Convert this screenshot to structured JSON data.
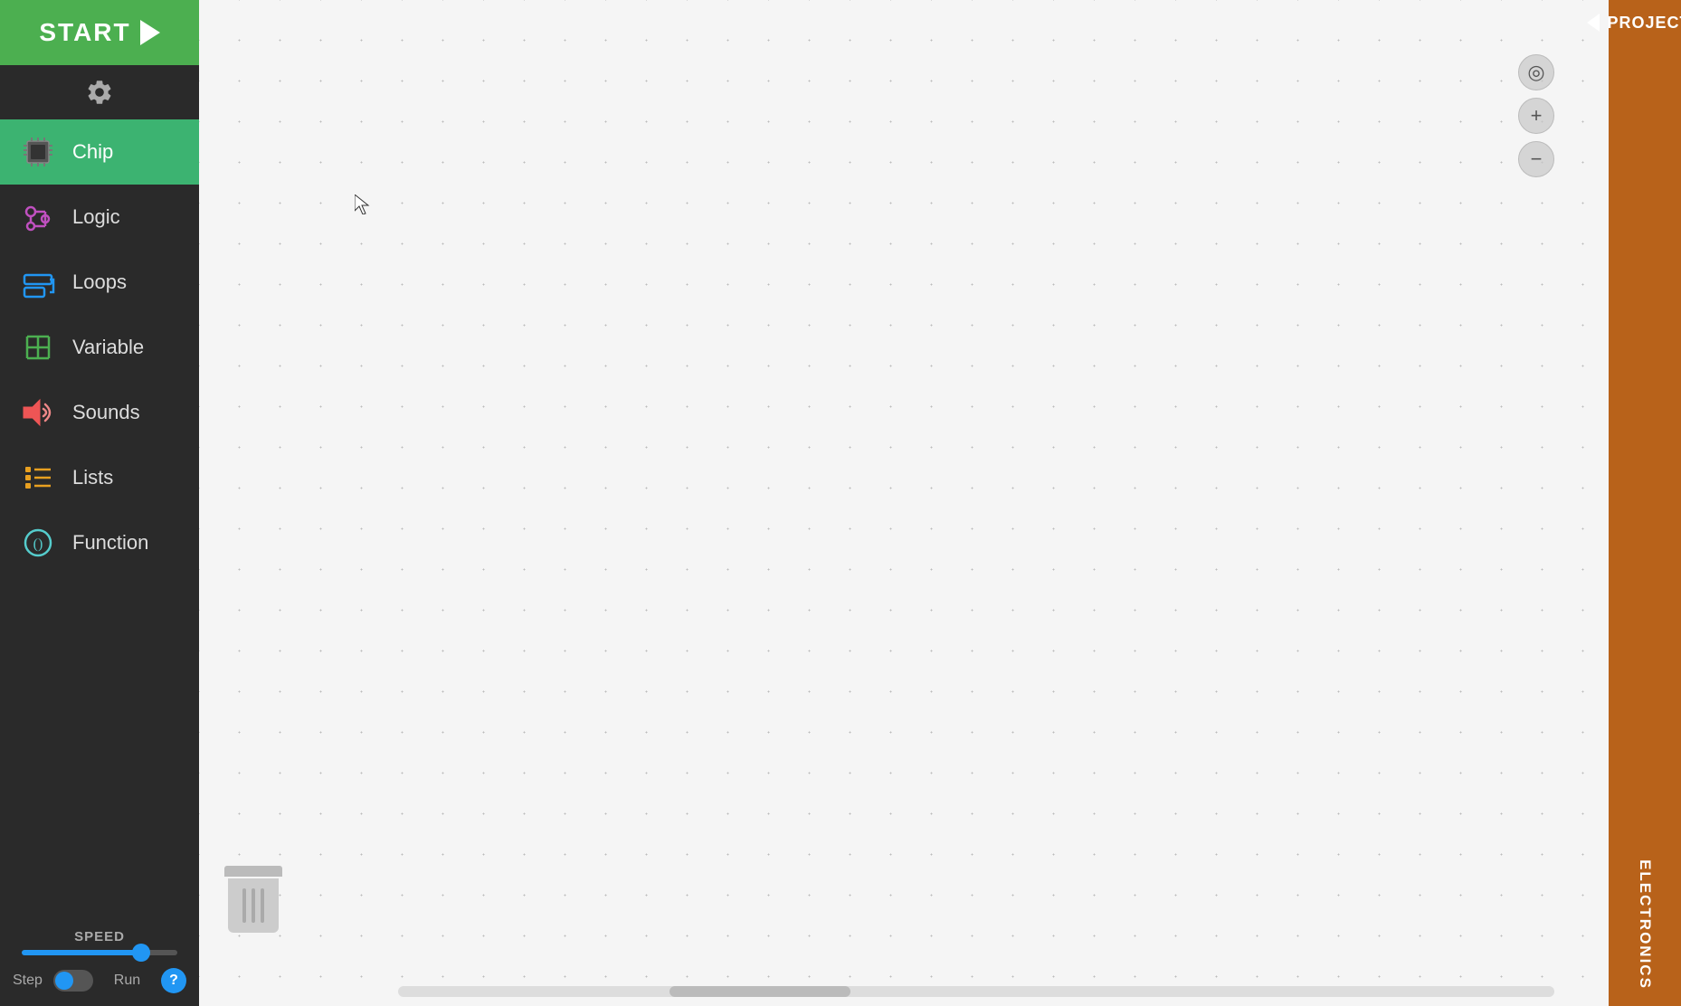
{
  "start": {
    "label": "START",
    "play_icon": "▶"
  },
  "settings": {
    "icon": "⚙"
  },
  "nav": {
    "items": [
      {
        "id": "chip",
        "label": "Chip",
        "active": true,
        "icon_type": "chip"
      },
      {
        "id": "logic",
        "label": "Logic",
        "active": false,
        "icon_type": "logic"
      },
      {
        "id": "loops",
        "label": "Loops",
        "active": false,
        "icon_type": "loops"
      },
      {
        "id": "variable",
        "label": "Variable",
        "active": false,
        "icon_type": "variable"
      },
      {
        "id": "sounds",
        "label": "Sounds",
        "active": false,
        "icon_type": "sounds"
      },
      {
        "id": "lists",
        "label": "Lists",
        "active": false,
        "icon_type": "lists"
      },
      {
        "id": "function",
        "label": "Function",
        "active": false,
        "icon_type": "function"
      }
    ]
  },
  "speed": {
    "label": "SPEED",
    "value": 80
  },
  "bottom_controls": {
    "step_label": "Step",
    "run_label": "Run",
    "help_label": "?"
  },
  "canvas_controls": {
    "locate_label": "◎",
    "zoom_in_label": "+",
    "zoom_out_label": "−"
  },
  "right_panel": {
    "projects_label": "PROJECTS",
    "electronics_label": "ELECTRONICS"
  }
}
